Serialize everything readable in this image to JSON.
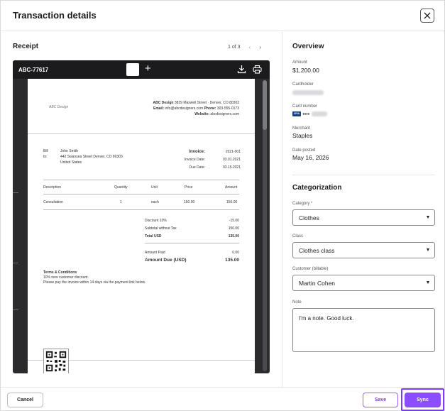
{
  "modal": {
    "title": "Transaction details"
  },
  "receipt": {
    "heading": "Receipt",
    "pager": "1 of 3",
    "doc_id": "ABC-77617",
    "paper": {
      "logo_text": "ABC Design",
      "company_line1_name": "ABC Design",
      "company_line1_addr": " 3839 Maxwell Street · Denver, CO 80303",
      "company_line2_email_lbl": "Email:",
      "company_line2_email": " info@abcdesigners.com  ",
      "company_line2_phone_lbl": "Phone:",
      "company_line2_phone": " 303-555-0173",
      "company_line3_web_lbl": "Website:",
      "company_line3_web": " abcdesigners.com",
      "bill_to_label": "Bill to:",
      "bill_to_name": "John Smith",
      "bill_to_street": "442 Swansea Street Denver, CO 80303",
      "bill_to_country": "United States",
      "invoice_label": "Invoice:",
      "invoice_value": "2021-001",
      "invoice_date_label": "Invoice Date:",
      "invoice_date": "03.01.2021",
      "due_date_label": "Due Date:",
      "due_date": "03.15.2021",
      "columns": [
        "Description",
        "Quantity",
        "Unit",
        "Price",
        "Amount"
      ],
      "row": [
        "Consultation",
        "1",
        "each",
        "150.00",
        "150.00"
      ],
      "discount_label": "Discount 10%",
      "discount_value": "-15.00",
      "subtotal_label": "Subtotal without Tax",
      "subtotal_value": "150.00",
      "total_label": "Total USD",
      "total_value": "135.00",
      "paid_label": "Amount Paid",
      "paid_value": "0.00",
      "due_label": "Amount Due (USD)",
      "due_value": "135.00",
      "terms_title": "Terms & Conditions",
      "terms_line1": "10% new customer discount.",
      "terms_line2": "Please pay the invoice within 14 days via the payment link below."
    }
  },
  "overview": {
    "heading": "Overview",
    "amount_label": "Amount",
    "amount": "$1,200.00",
    "cardholder_label": "Cardholder",
    "card_label": "Card number",
    "card_brand": "VISA",
    "card_mask": "••••",
    "merchant_label": "Merchant",
    "merchant": "Staples",
    "date_label": "Date posted",
    "date": "May 16, 2026"
  },
  "categorization": {
    "heading": "Categorization",
    "category_label": "Category *",
    "category": "Clothes",
    "class_label": "Class",
    "class": "Clothes class",
    "customer_label": "Customer (billable)",
    "customer": "Martin Cohen",
    "note_label": "Note",
    "note": "I'm a note. Good luck."
  },
  "footer": {
    "cancel": "Cancel",
    "save": "Save",
    "sync": "Sync"
  },
  "colors": {
    "accent": "#8a4dff",
    "accent_outline": "#7b3cff",
    "viewer_bg": "#2b2b2e"
  }
}
